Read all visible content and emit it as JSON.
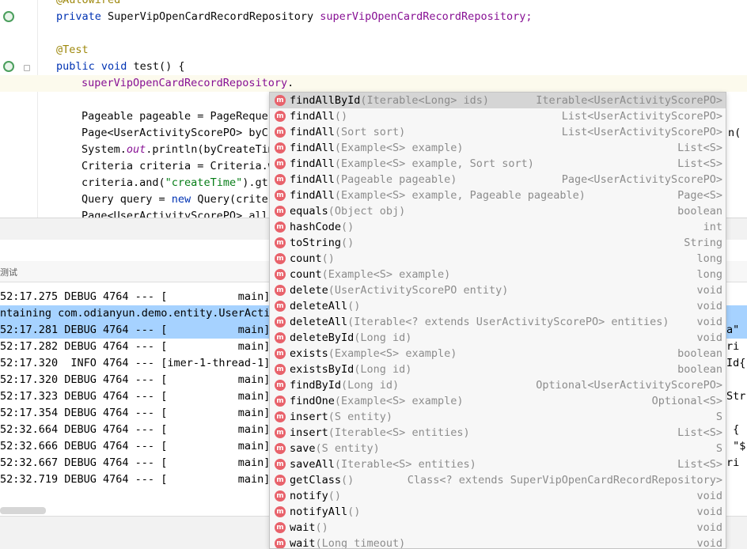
{
  "editor": {
    "lines": [
      {
        "kind": "ann",
        "text": "@Autowired"
      },
      {
        "kind": "decl",
        "kw": "private",
        "type": "SuperVipOpenCardRecordRepository",
        "field": "superVipOpenCardRecordRepository;"
      },
      {
        "kind": "blank",
        "text": ""
      },
      {
        "kind": "ann",
        "text": "@Test"
      },
      {
        "kind": "method",
        "kw": "public void",
        "rest": "test() {"
      },
      {
        "kind": "current",
        "field": "superVipOpenCardRecordRepository",
        "rest": "."
      },
      {
        "kind": "blank",
        "text": ""
      },
      {
        "kind": "plain",
        "text": "Pageable pageable = PageReques"
      },
      {
        "kind": "plain",
        "text": "Page<UserActivityScorePO> byCr"
      },
      {
        "kind": "sysout",
        "pre": "System.",
        "ital": "out",
        "post": ".println(byCreateTim"
      },
      {
        "kind": "plain",
        "text": "Criteria criteria = Criteria.w"
      },
      {
        "kind": "crit",
        "pre": "criteria.and(",
        "str": "\"createTime\"",
        "post": ").gt("
      },
      {
        "kind": "query",
        "pre": "Query query = ",
        "kw": "new",
        "post": " Query(criter"
      },
      {
        "kind": "plain",
        "text": "Page<UserActivityScorePO> all"
      }
    ],
    "right_fragments": [
      "n(",
      "",
      ""
    ]
  },
  "run_panel": {
    "tab_label": "测试"
  },
  "console": {
    "lines": [
      {
        "text": "52:17.275 DEBUG 4764 --- [           main]",
        "selected": false
      },
      {
        "text": "ntaining com.odianyun.demo.entity.UserActiv",
        "selected": true
      },
      {
        "text": "52:17.281 DEBUG 4764 --- [           main]",
        "selected": true
      },
      {
        "text": "52:17.282 DEBUG 4764 --- [           main]",
        "selected": false
      },
      {
        "text": "52:17.320  INFO 4764 --- [imer-1-thread-1]",
        "selected": false
      },
      {
        "text": "52:17.320 DEBUG 4764 --- [           main]",
        "selected": false
      },
      {
        "text": "52:17.323 DEBUG 4764 --- [           main]",
        "selected": false
      },
      {
        "text": "52:17.354 DEBUG 4764 --- [           main]",
        "selected": false
      },
      {
        "text": "52:32.664 DEBUG 4764 --- [           main]",
        "selected": false
      },
      {
        "text": "52:32.666 DEBUG 4764 --- [           main]",
        "selected": false
      },
      {
        "text": "52:32.667 DEBUG 4764 --- [           main]",
        "selected": false
      },
      {
        "text": "52:32.719 DEBUG 4764 --- [           main]",
        "selected": false
      }
    ],
    "right_fragments": [
      "",
      "",
      "a\"",
      "ri",
      "Id{",
      "",
      "Str",
      "",
      " {",
      " \"$",
      "ri",
      ""
    ]
  },
  "completion": {
    "icon_letter": "m",
    "items": [
      {
        "name": "findAllById",
        "params": "(Iterable<Long> ids)",
        "type": "Iterable<UserActivityScorePO>"
      },
      {
        "name": "findAll",
        "params": "()",
        "type": "List<UserActivityScorePO>"
      },
      {
        "name": "findAll",
        "params": "(Sort sort)",
        "type": "List<UserActivityScorePO>"
      },
      {
        "name": "findAll",
        "params": "(Example<S> example)",
        "type": "List<S>"
      },
      {
        "name": "findAll",
        "params": "(Example<S> example, Sort sort)",
        "type": "List<S>"
      },
      {
        "name": "findAll",
        "params": "(Pageable pageable)",
        "type": "Page<UserActivityScorePO>"
      },
      {
        "name": "findAll",
        "params": "(Example<S> example, Pageable pageable)",
        "type": "Page<S>"
      },
      {
        "name": "equals",
        "params": "(Object obj)",
        "type": "boolean"
      },
      {
        "name": "hashCode",
        "params": "()",
        "type": "int"
      },
      {
        "name": "toString",
        "params": "()",
        "type": "String"
      },
      {
        "name": "count",
        "params": "()",
        "type": "long"
      },
      {
        "name": "count",
        "params": "(Example<S> example)",
        "type": "long"
      },
      {
        "name": "delete",
        "params": "(UserActivityScorePO entity)",
        "type": "void"
      },
      {
        "name": "deleteAll",
        "params": "()",
        "type": "void"
      },
      {
        "name": "deleteAll",
        "params": "(Iterable<? extends UserActivityScorePO> entities)",
        "type": "void"
      },
      {
        "name": "deleteById",
        "params": "(Long id)",
        "type": "void"
      },
      {
        "name": "exists",
        "params": "(Example<S> example)",
        "type": "boolean"
      },
      {
        "name": "existsById",
        "params": "(Long id)",
        "type": "boolean"
      },
      {
        "name": "findById",
        "params": "(Long id)",
        "type": "Optional<UserActivityScorePO>"
      },
      {
        "name": "findOne",
        "params": "(Example<S> example)",
        "type": "Optional<S>"
      },
      {
        "name": "insert",
        "params": "(S entity)",
        "type": "S"
      },
      {
        "name": "insert",
        "params": "(Iterable<S> entities)",
        "type": "List<S>"
      },
      {
        "name": "save",
        "params": "(S entity)",
        "type": "S"
      },
      {
        "name": "saveAll",
        "params": "(Iterable<S> entities)",
        "type": "List<S>"
      },
      {
        "name": "getClass",
        "params": "()",
        "type": "Class<? extends SuperVipOpenCardRecordRepository>"
      },
      {
        "name": "notify",
        "params": "()",
        "type": "void"
      },
      {
        "name": "notifyAll",
        "params": "()",
        "type": "void"
      },
      {
        "name": "wait",
        "params": "()",
        "type": "void"
      },
      {
        "name": "wait",
        "params": "(Long timeout)",
        "type": "void"
      }
    ],
    "selected_index": 0
  },
  "colors": {
    "annotation": "#9e880d",
    "keyword": "#0033b3",
    "field": "#871094",
    "string": "#067d17",
    "selection": "#a6d2ff",
    "method_icon": "#e8626b"
  }
}
